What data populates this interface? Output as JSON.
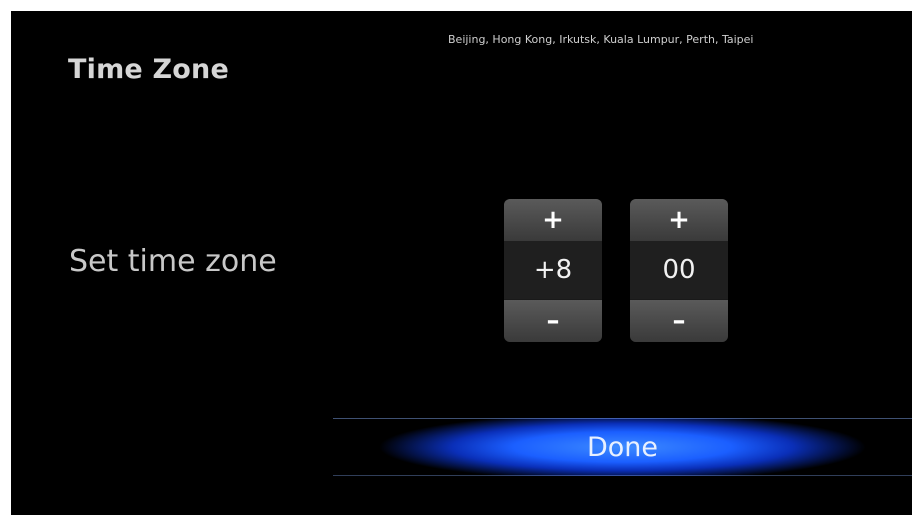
{
  "header": {
    "title": "Time Zone",
    "zone_cities": "Beijing, Hong Kong, Irkutsk, Kuala Lumpur, Perth, Taipei"
  },
  "setting": {
    "label": "Set time zone"
  },
  "spinners": {
    "hours": {
      "increment_label": "+",
      "value": "+8",
      "decrement_label": "–"
    },
    "minutes": {
      "increment_label": "+",
      "value": "00",
      "decrement_label": "–"
    }
  },
  "actions": {
    "done_label": "Done",
    "accent_color": "#1b5fff"
  }
}
